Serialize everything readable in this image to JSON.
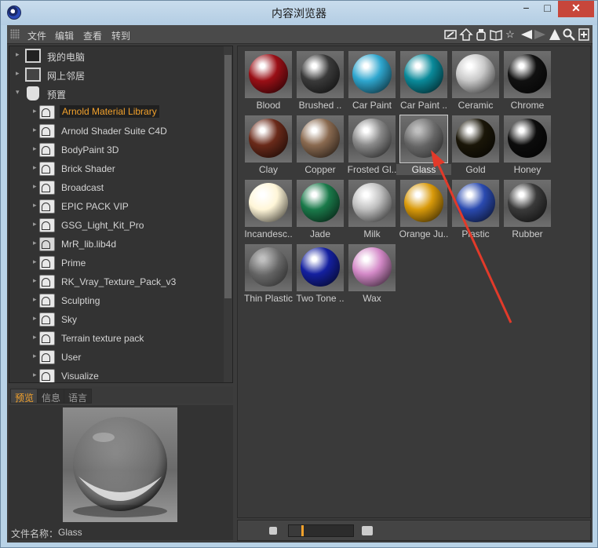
{
  "window": {
    "title": "内容浏览器",
    "minimize": "−",
    "maximize": "□",
    "close": "✕"
  },
  "menu": [
    "文件",
    "编辑",
    "查看",
    "转到"
  ],
  "toolbar_icons": [
    "edit-icon",
    "home-icon",
    "bottle-icon",
    "book-icon",
    "star-icon",
    "back-icon",
    "forward-icon",
    "up-icon",
    "search-icon",
    "new-tab-icon"
  ],
  "tree": {
    "roots": [
      {
        "label": "我的电脑",
        "icon": "computer-icon"
      },
      {
        "label": "网上邻居",
        "icon": "network-icon"
      },
      {
        "label": "预置",
        "icon": "preset-icon"
      }
    ],
    "items": [
      {
        "label": "Arnold Material Library",
        "selected": true
      },
      {
        "label": "Arnold Shader Suite C4D"
      },
      {
        "label": "BodyPaint 3D"
      },
      {
        "label": "Brick Shader"
      },
      {
        "label": "Broadcast"
      },
      {
        "label": "EPIC PACK VIP"
      },
      {
        "label": "GSG_Light_Kit_Pro"
      },
      {
        "label": "MrR_lib.lib4d"
      },
      {
        "label": "Prime"
      },
      {
        "label": "RK_Vray_Texture_Pack_v3"
      },
      {
        "label": "Sculpting"
      },
      {
        "label": "Sky"
      },
      {
        "label": "Terrain texture pack"
      },
      {
        "label": "User"
      },
      {
        "label": "Visualize"
      }
    ]
  },
  "preview_tabs": [
    "预览",
    "信息",
    "语言"
  ],
  "preview": {
    "filename_label": "文件名称：",
    "filename": "Glass"
  },
  "materials": [
    {
      "label": "Blood",
      "color": "#9a0f16"
    },
    {
      "label": "Brushed ..",
      "color": "#3a3a3a"
    },
    {
      "label": "Car Paint",
      "color": "#2fa7cf"
    },
    {
      "label": "Car Paint ..",
      "color": "#0a8a9a"
    },
    {
      "label": "Ceramic",
      "color": "#c8c8c8"
    },
    {
      "label": "Chrome",
      "color": "#111111"
    },
    {
      "label": "Clay",
      "color": "#6a2a1a"
    },
    {
      "label": "Copper",
      "color": "#8a6a50"
    },
    {
      "label": "Frosted Gl..",
      "color": "#8a8a8a"
    },
    {
      "label": "Glass",
      "color": "#777777",
      "selected": true
    },
    {
      "label": "Gold",
      "color": "#1a1608"
    },
    {
      "label": "Honey",
      "color": "#0c0c0c"
    },
    {
      "label": "Incandesc..",
      "color": "#fff6d8"
    },
    {
      "label": "Jade",
      "color": "#1a7a4a"
    },
    {
      "label": "Milk",
      "color": "#bfbfbf"
    },
    {
      "label": "Orange Ju..",
      "color": "#d99a0a"
    },
    {
      "label": "Plastic",
      "color": "#2a4ab0"
    },
    {
      "label": "Rubber",
      "color": "#3a3a3a"
    },
    {
      "label": "Thin Plastic",
      "color": "#9a9a9a"
    },
    {
      "label": "Two Tone ..",
      "color": "#1420a0"
    },
    {
      "label": "Wax",
      "color": "#d48ac8"
    }
  ],
  "zoom_level": 0.2,
  "annotation_color": "#e23a2a"
}
